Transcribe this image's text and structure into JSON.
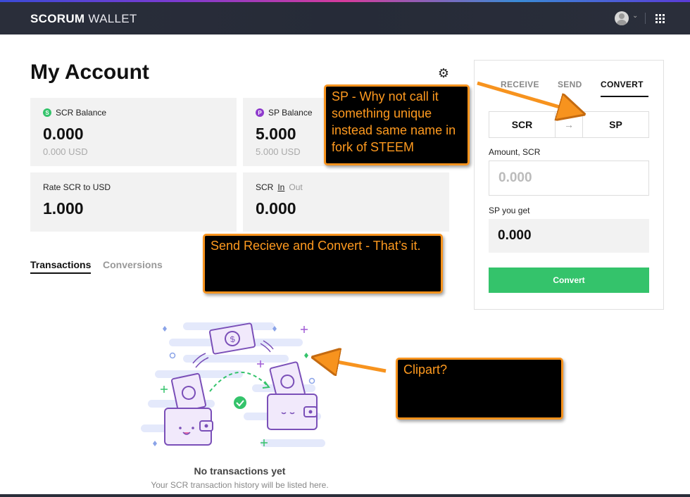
{
  "header": {
    "logo_bold": "SCORUM",
    "logo_light": "WALLET",
    "avatar_chevron": "⌄",
    "menu_icon": "grid-icon"
  },
  "main": {
    "title": "My Account",
    "settings_icon": "⚙",
    "cards": {
      "scr_balance": {
        "label": "SCR Balance",
        "badge": "S",
        "value": "0.000",
        "sub": "0.000 USD"
      },
      "sp_balance": {
        "label": "SP Balance",
        "badge": "P",
        "value": "5.000",
        "sub": "5.000 USD"
      },
      "rate": {
        "label": "Rate SCR to USD",
        "value": "1.000"
      },
      "scr_inout": {
        "label": "SCR",
        "in": "In",
        "out": "Out",
        "value": "0.000"
      }
    },
    "tabs": {
      "transactions": "Transactions",
      "conversions": "Conversions"
    },
    "empty": {
      "title": "No transactions yet",
      "subtitle": "Your SCR transaction history will be listed here."
    }
  },
  "panel": {
    "tabs": {
      "receive": "RECEIVE",
      "send": "SEND",
      "convert": "CONVERT"
    },
    "from": "SCR",
    "arrow": "→",
    "to": "SP",
    "amount_label": "Amount, SCR",
    "amount_placeholder": "0.000",
    "get_label": "SP you get",
    "get_value": "0.000",
    "button": "Convert"
  },
  "annotations": {
    "sp_note": "SP - Why not call it something unique instead same name in fork of STEEM",
    "send_note": "Send Recieve and Convert - That’s it.",
    "clipart_note": "Clipart?"
  },
  "colors": {
    "accent_green": "#34c36b",
    "sp_purple": "#8e3bcc",
    "topbar": "#2a2e3a",
    "annotation_orange": "#f7931e"
  }
}
